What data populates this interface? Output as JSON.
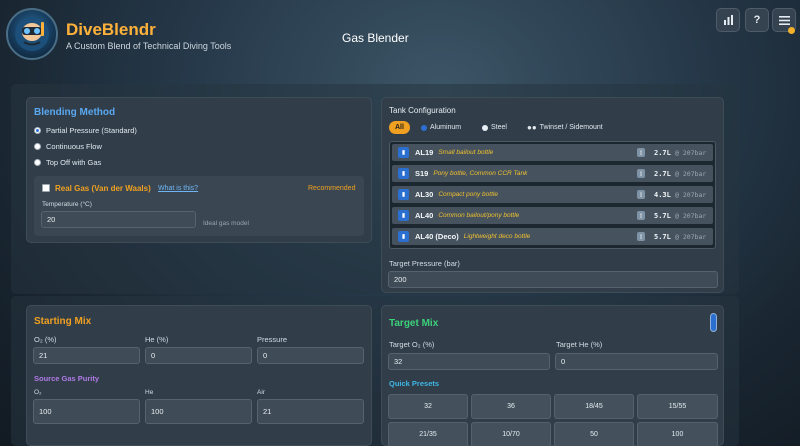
{
  "app": {
    "brand": "DiveBlendr",
    "tagline": "A Custom Blend of Technical Diving Tools",
    "page_title": "Gas Blender",
    "accent": "#ffb23a"
  },
  "header_buttons": [
    {
      "name": "stats-icon",
      "glyph": "▐▌"
    },
    {
      "name": "help-icon",
      "glyph": "?"
    },
    {
      "name": "menu-icon",
      "glyph": "≡"
    }
  ],
  "blending": {
    "title": "Blending Method",
    "options": [
      "Partial Pressure (Standard)",
      "Continuous Flow",
      "Top Off with Gas"
    ],
    "selected": 0,
    "real_gas_label": "Real Gas (Van der Waals)",
    "what_is_this": "What is this?",
    "recommended": "Recommended",
    "temperature_label": "Temperature (°C)",
    "temperature_value": "20",
    "ideal_gas_note": "Ideal gas model"
  },
  "tank": {
    "title": "Tank Configuration",
    "filters": [
      "All",
      "Aluminum",
      "Steel",
      "Twinset / Sidemount"
    ],
    "rows": [
      {
        "name": "AL19",
        "desc": "Small bailout bottle",
        "volume": "2.7L",
        "pressure": "@ 207bar"
      },
      {
        "name": "S19",
        "desc": "Pony bottle, Common CCR Tank",
        "volume": "2.7L",
        "pressure": "@ 207bar"
      },
      {
        "name": "AL30",
        "desc": "Compact pony bottle",
        "volume": "4.3L",
        "pressure": "@ 207bar"
      },
      {
        "name": "AL40",
        "desc": "Common bailout/pony bottle",
        "volume": "5.7L",
        "pressure": "@ 207bar"
      },
      {
        "name": "AL40 (Deco)",
        "desc": "Lightweight deco bottle",
        "volume": "5.7L",
        "pressure": "@ 207bar"
      }
    ],
    "target_pressure_label": "Target Pressure (bar)",
    "target_pressure_value": "200"
  },
  "starting_mix": {
    "title": "Starting Mix",
    "o2_label": "O₂ (%)",
    "o2_value": "21",
    "he_label": "He (%)",
    "he_value": "0",
    "pressure_label": "Pressure",
    "pressure_value": "0",
    "purity_title": "Source Gas Purity",
    "purity_o2_label": "O₂",
    "purity_o2_value": "100",
    "purity_he_label": "He",
    "purity_he_value": "100",
    "purity_air_label": "Air",
    "purity_air_value": "21"
  },
  "target_mix": {
    "title": "Target Mix",
    "o2_label": "Target O₂ (%)",
    "o2_value": "32",
    "he_label": "Target He (%)",
    "he_value": "0",
    "presets_title": "Quick Presets",
    "presets": [
      "32",
      "36",
      "18/45",
      "15/55",
      "21/35",
      "10/70",
      "50",
      "100"
    ]
  }
}
